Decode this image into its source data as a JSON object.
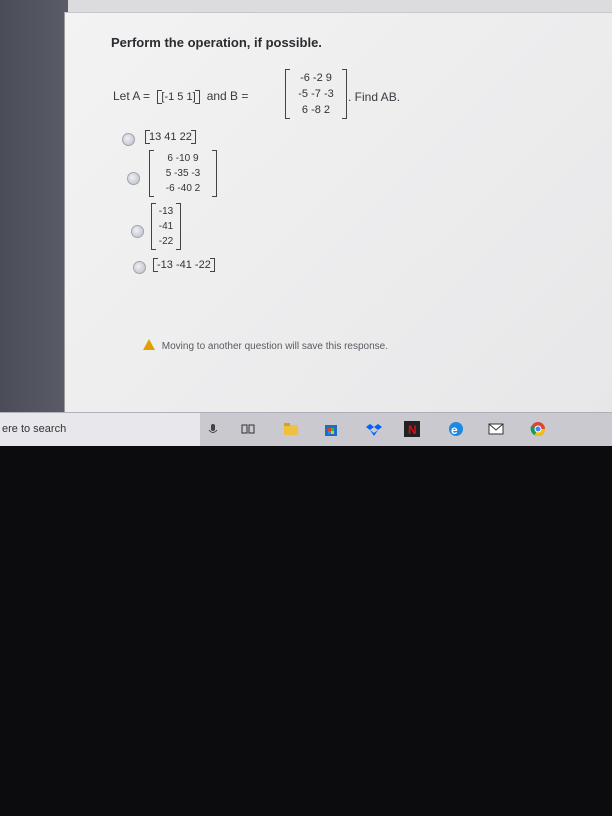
{
  "question": {
    "title": "Perform the operation, if possible.",
    "let_a": "Let A =",
    "matrix_a": "[-1  5  1]",
    "and_b": "and B =",
    "matrix_b_rows": [
      "-6 -2  9",
      "-5 -7 -3",
      "6 -8  2"
    ],
    "find": ". Find AB."
  },
  "options": [
    {
      "kind": "row",
      "value": "13 41 22"
    },
    {
      "kind": "matrix",
      "rows": [
        "6  -10  9",
        "5  -35 -3",
        "-6 -40  2"
      ]
    },
    {
      "kind": "column",
      "rows": [
        "-13",
        "-41",
        "-22"
      ]
    },
    {
      "kind": "row",
      "value": "-13 -41 -22"
    }
  ],
  "notice": "Moving to another question will save this response.",
  "taskbar": {
    "search_text": "ere to search",
    "icons": [
      "microphone-icon",
      "task-view-icon",
      "file-explorer-icon",
      "store-icon",
      "dropbox-icon",
      "netflix-icon",
      "edge-icon",
      "mail-icon",
      "chrome-icon"
    ]
  },
  "colors": {
    "accent": "#0078d7",
    "warning": "#e0a000",
    "taskbar": "#c9c9cf"
  }
}
